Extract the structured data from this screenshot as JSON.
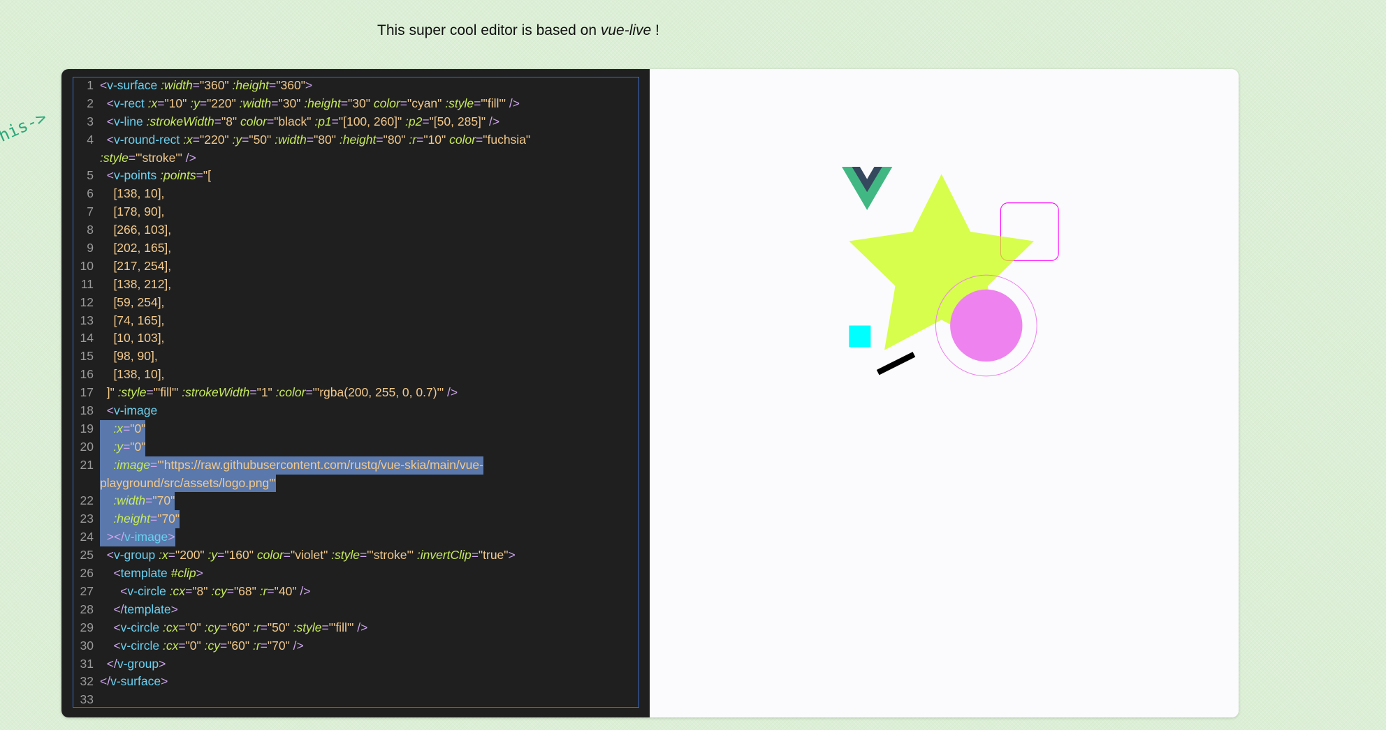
{
  "header": {
    "text_before": "This super cool editor is based on ",
    "link": "vue-live",
    "text_after": " !"
  },
  "hint": {
    "text": "this->"
  },
  "colors": {
    "tag": "#6ad0f0",
    "attr": "#c6e95d",
    "value": "#f2c98b",
    "punct": "#cfa7ee",
    "selection": "#5a78ab",
    "editor_bg": "#1f1f1f",
    "star_fill": "rgba(200, 255, 0, 0.7)"
  },
  "editor": {
    "lines": [
      {
        "n": "1",
        "sel": false,
        "parts": [
          [
            "p",
            "<"
          ],
          [
            "t",
            "v-surface "
          ],
          [
            "a",
            ":width"
          ],
          [
            "p",
            "="
          ],
          [
            "v",
            "\"360\" "
          ],
          [
            "a",
            ":height"
          ],
          [
            "p",
            "="
          ],
          [
            "v",
            "\"360\""
          ],
          [
            "p",
            ">"
          ]
        ]
      },
      {
        "n": "2",
        "sel": false,
        "parts": [
          [
            "p",
            "  <"
          ],
          [
            "t",
            "v-rect "
          ],
          [
            "a",
            ":x"
          ],
          [
            "p",
            "="
          ],
          [
            "v",
            "\"10\" "
          ],
          [
            "a",
            ":y"
          ],
          [
            "p",
            "="
          ],
          [
            "v",
            "\"220\" "
          ],
          [
            "a",
            ":width"
          ],
          [
            "p",
            "="
          ],
          [
            "v",
            "\"30\" "
          ],
          [
            "a",
            ":height"
          ],
          [
            "p",
            "="
          ],
          [
            "v",
            "\"30\" "
          ],
          [
            "a",
            "color"
          ],
          [
            "p",
            "="
          ],
          [
            "v",
            "\"cyan\" "
          ],
          [
            "a",
            ":style"
          ],
          [
            "p",
            "="
          ],
          [
            "v",
            "\"'fill'\" "
          ],
          [
            "p",
            "/>"
          ]
        ]
      },
      {
        "n": "3",
        "sel": false,
        "parts": [
          [
            "p",
            "  <"
          ],
          [
            "t",
            "v-line "
          ],
          [
            "a",
            ":strokeWidth"
          ],
          [
            "p",
            "="
          ],
          [
            "v",
            "\"8\" "
          ],
          [
            "a",
            "color"
          ],
          [
            "p",
            "="
          ],
          [
            "v",
            "\"black\" "
          ],
          [
            "a",
            ":p1"
          ],
          [
            "p",
            "="
          ],
          [
            "v",
            "\"[100, 260]\" "
          ],
          [
            "a",
            ":p2"
          ],
          [
            "p",
            "="
          ],
          [
            "v",
            "\"[50, 285]\" "
          ],
          [
            "p",
            "/>"
          ]
        ]
      },
      {
        "n": "4",
        "sel": false,
        "parts": [
          [
            "p",
            "  <"
          ],
          [
            "t",
            "v-round-rect "
          ],
          [
            "a",
            ":x"
          ],
          [
            "p",
            "="
          ],
          [
            "v",
            "\"220\" "
          ],
          [
            "a",
            ":y"
          ],
          [
            "p",
            "="
          ],
          [
            "v",
            "\"50\" "
          ],
          [
            "a",
            ":width"
          ],
          [
            "p",
            "="
          ],
          [
            "v",
            "\"80\" "
          ],
          [
            "a",
            ":height"
          ],
          [
            "p",
            "="
          ],
          [
            "v",
            "\"80\" "
          ],
          [
            "a",
            ":r"
          ],
          [
            "p",
            "="
          ],
          [
            "v",
            "\"10\" "
          ],
          [
            "a",
            "color"
          ],
          [
            "p",
            "="
          ],
          [
            "v",
            "\"fuchsia\""
          ]
        ]
      },
      {
        "n": "",
        "sel": false,
        "parts": [
          [
            "a",
            ":style"
          ],
          [
            "p",
            "="
          ],
          [
            "v",
            "\"'stroke'\" "
          ],
          [
            "p",
            "/>"
          ]
        ]
      },
      {
        "n": "5",
        "sel": false,
        "parts": [
          [
            "p",
            "  <"
          ],
          [
            "t",
            "v-points "
          ],
          [
            "a",
            ":points"
          ],
          [
            "p",
            "="
          ],
          [
            "v",
            "\"["
          ]
        ]
      },
      {
        "n": "6",
        "sel": false,
        "parts": [
          [
            "v",
            "    [138, 10],"
          ]
        ]
      },
      {
        "n": "7",
        "sel": false,
        "parts": [
          [
            "v",
            "    [178, 90],"
          ]
        ]
      },
      {
        "n": "8",
        "sel": false,
        "parts": [
          [
            "v",
            "    [266, 103],"
          ]
        ]
      },
      {
        "n": "9",
        "sel": false,
        "parts": [
          [
            "v",
            "    [202, 165],"
          ]
        ]
      },
      {
        "n": "10",
        "sel": false,
        "parts": [
          [
            "v",
            "    [217, 254],"
          ]
        ]
      },
      {
        "n": "11",
        "sel": false,
        "parts": [
          [
            "v",
            "    [138, 212],"
          ]
        ]
      },
      {
        "n": "12",
        "sel": false,
        "parts": [
          [
            "v",
            "    [59, 254],"
          ]
        ]
      },
      {
        "n": "13",
        "sel": false,
        "parts": [
          [
            "v",
            "    [74, 165],"
          ]
        ]
      },
      {
        "n": "14",
        "sel": false,
        "parts": [
          [
            "v",
            "    [10, 103],"
          ]
        ]
      },
      {
        "n": "15",
        "sel": false,
        "parts": [
          [
            "v",
            "    [98, 90],"
          ]
        ]
      },
      {
        "n": "16",
        "sel": false,
        "parts": [
          [
            "v",
            "    [138, 10],"
          ]
        ]
      },
      {
        "n": "17",
        "sel": false,
        "parts": [
          [
            "v",
            "  ]\" "
          ],
          [
            "a",
            ":style"
          ],
          [
            "p",
            "="
          ],
          [
            "v",
            "\"'fill'\" "
          ],
          [
            "a",
            ":strokeWidth"
          ],
          [
            "p",
            "="
          ],
          [
            "v",
            "\"1\" "
          ],
          [
            "a",
            ":color"
          ],
          [
            "p",
            "="
          ],
          [
            "v",
            "\"'rgba(200, 255, 0, 0.7)'\" "
          ],
          [
            "p",
            "/>"
          ]
        ]
      },
      {
        "n": "18",
        "sel": false,
        "parts": [
          [
            "p",
            "  <"
          ],
          [
            "t",
            "v-image"
          ]
        ]
      },
      {
        "n": "19",
        "sel": true,
        "parts": [
          [
            "a",
            "    :x"
          ],
          [
            "p",
            "="
          ],
          [
            "v",
            "\"0\""
          ]
        ]
      },
      {
        "n": "20",
        "sel": true,
        "parts": [
          [
            "a",
            "    :y"
          ],
          [
            "p",
            "="
          ],
          [
            "v",
            "\"0\""
          ]
        ]
      },
      {
        "n": "21",
        "sel": true,
        "parts": [
          [
            "a",
            "    :image"
          ],
          [
            "p",
            "="
          ],
          [
            "v",
            "\"'https://raw.githubusercontent.com/rustq/vue-skia/main/vue-"
          ]
        ]
      },
      {
        "n": "",
        "sel": true,
        "parts": [
          [
            "v",
            "playground/src/assets/logo.png'\""
          ]
        ]
      },
      {
        "n": "22",
        "sel": true,
        "parts": [
          [
            "a",
            "    :width"
          ],
          [
            "p",
            "="
          ],
          [
            "v",
            "\"70\""
          ]
        ]
      },
      {
        "n": "23",
        "sel": true,
        "parts": [
          [
            "a",
            "    :height"
          ],
          [
            "p",
            "="
          ],
          [
            "v",
            "\"70\""
          ]
        ]
      },
      {
        "n": "24",
        "sel": true,
        "parts": [
          [
            "p",
            "  ></"
          ],
          [
            "t",
            "v-image"
          ],
          [
            "p",
            ">"
          ]
        ]
      },
      {
        "n": "25",
        "sel": false,
        "parts": [
          [
            "p",
            "  <"
          ],
          [
            "t",
            "v-group "
          ],
          [
            "a",
            ":x"
          ],
          [
            "p",
            "="
          ],
          [
            "v",
            "\"200\" "
          ],
          [
            "a",
            ":y"
          ],
          [
            "p",
            "="
          ],
          [
            "v",
            "\"160\" "
          ],
          [
            "a",
            "color"
          ],
          [
            "p",
            "="
          ],
          [
            "v",
            "\"violet\" "
          ],
          [
            "a",
            ":style"
          ],
          [
            "p",
            "="
          ],
          [
            "v",
            "\"'stroke'\" "
          ],
          [
            "a",
            ":invertClip"
          ],
          [
            "p",
            "="
          ],
          [
            "v",
            "\"true\""
          ],
          [
            "p",
            ">"
          ]
        ]
      },
      {
        "n": "26",
        "sel": false,
        "parts": [
          [
            "p",
            "    <"
          ],
          [
            "t",
            "template "
          ],
          [
            "a",
            "#clip"
          ],
          [
            "p",
            ">"
          ]
        ]
      },
      {
        "n": "27",
        "sel": false,
        "parts": [
          [
            "p",
            "      <"
          ],
          [
            "t",
            "v-circle "
          ],
          [
            "a",
            ":cx"
          ],
          [
            "p",
            "="
          ],
          [
            "v",
            "\"8\" "
          ],
          [
            "a",
            ":cy"
          ],
          [
            "p",
            "="
          ],
          [
            "v",
            "\"68\" "
          ],
          [
            "a",
            ":r"
          ],
          [
            "p",
            "="
          ],
          [
            "v",
            "\"40\" "
          ],
          [
            "p",
            "/>"
          ]
        ]
      },
      {
        "n": "28",
        "sel": false,
        "parts": [
          [
            "p",
            "    </"
          ],
          [
            "t",
            "template"
          ],
          [
            "p",
            ">"
          ]
        ]
      },
      {
        "n": "29",
        "sel": false,
        "parts": [
          [
            "p",
            "    <"
          ],
          [
            "t",
            "v-circle "
          ],
          [
            "a",
            ":cx"
          ],
          [
            "p",
            "="
          ],
          [
            "v",
            "\"0\" "
          ],
          [
            "a",
            ":cy"
          ],
          [
            "p",
            "="
          ],
          [
            "v",
            "\"60\" "
          ],
          [
            "a",
            ":r"
          ],
          [
            "p",
            "="
          ],
          [
            "v",
            "\"50\" "
          ],
          [
            "a",
            ":style"
          ],
          [
            "p",
            "="
          ],
          [
            "v",
            "\"'fill'\" "
          ],
          [
            "p",
            "/>"
          ]
        ]
      },
      {
        "n": "30",
        "sel": false,
        "parts": [
          [
            "p",
            "    <"
          ],
          [
            "t",
            "v-circle "
          ],
          [
            "a",
            ":cx"
          ],
          [
            "p",
            "="
          ],
          [
            "v",
            "\"0\" "
          ],
          [
            "a",
            ":cy"
          ],
          [
            "p",
            "="
          ],
          [
            "v",
            "\"60\" "
          ],
          [
            "a",
            ":r"
          ],
          [
            "p",
            "="
          ],
          [
            "v",
            "\"70\" "
          ],
          [
            "p",
            "/>"
          ]
        ]
      },
      {
        "n": "31",
        "sel": false,
        "parts": [
          [
            "p",
            "  </"
          ],
          [
            "t",
            "v-group"
          ],
          [
            "p",
            ">"
          ]
        ]
      },
      {
        "n": "32",
        "sel": false,
        "parts": [
          [
            "p",
            "</"
          ],
          [
            "t",
            "v-surface"
          ],
          [
            "p",
            ">"
          ]
        ]
      },
      {
        "n": "33",
        "sel": false,
        "parts": []
      }
    ]
  }
}
